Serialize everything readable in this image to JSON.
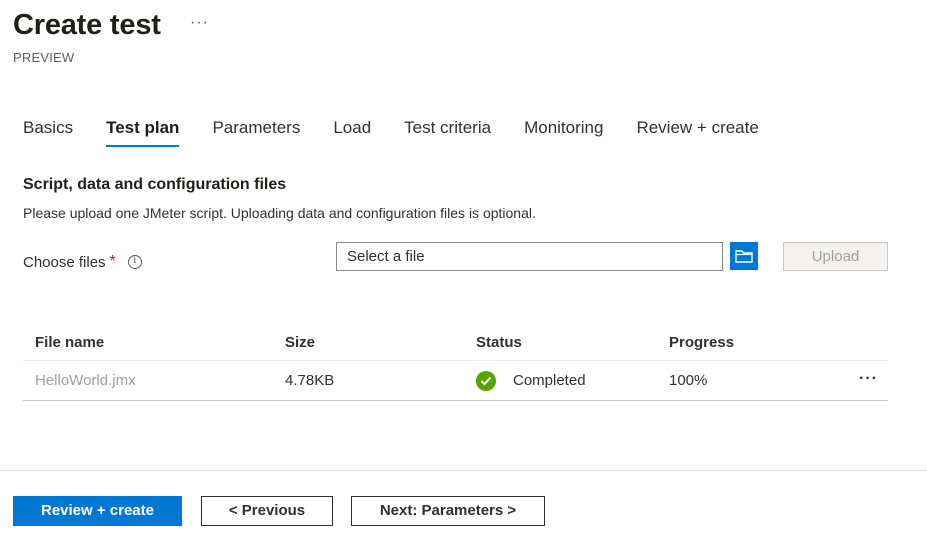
{
  "header": {
    "title": "Create test",
    "more": "···",
    "subtitle": "PREVIEW"
  },
  "tabs": [
    {
      "label": "Basics",
      "active": false
    },
    {
      "label": "Test plan",
      "active": true
    },
    {
      "label": "Parameters",
      "active": false
    },
    {
      "label": "Load",
      "active": false
    },
    {
      "label": "Test criteria",
      "active": false
    },
    {
      "label": "Monitoring",
      "active": false
    },
    {
      "label": "Review + create",
      "active": false
    }
  ],
  "section": {
    "title": "Script, data and configuration files",
    "description": "Please upload one JMeter script. Uploading data and configuration files is optional."
  },
  "choose_files": {
    "label": "Choose files",
    "required_marker": "*",
    "placeholder": "Select a file",
    "upload_label": "Upload"
  },
  "table": {
    "headers": [
      "File name",
      "Size",
      "Status",
      "Progress"
    ],
    "rows": [
      {
        "file_name": "HelloWorld.jmx",
        "size": "4.78KB",
        "status": "Completed",
        "progress": "100%",
        "more": "···"
      }
    ]
  },
  "footer": {
    "review_create": "Review + create",
    "previous": "< Previous",
    "next": "Next: Parameters >"
  },
  "colors": {
    "accent": "#0078d4",
    "success": "#57a300",
    "required": "#a4262c"
  }
}
